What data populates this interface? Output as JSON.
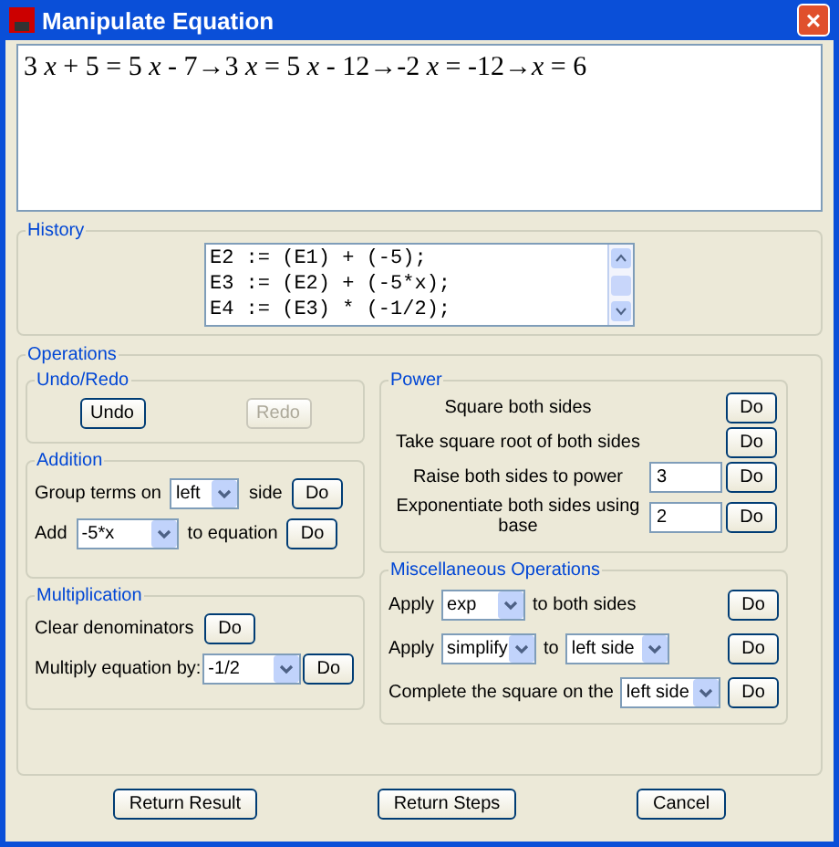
{
  "window": {
    "title": "Manipulate Equation",
    "close": "×"
  },
  "equation": "3 *x* + 5 = 5 *x* - 7→3 *x* = 5 *x* - 12→-2 *x* = -12→*x* = 6",
  "history": {
    "title": "History",
    "lines": [
      "E2 := (E1) + (-5);",
      "E3 := (E2) + (-5*x);",
      "E4 := (E3) * (-1/2);"
    ]
  },
  "operations": {
    "title": "Operations",
    "undo_redo": {
      "title": "Undo/Redo",
      "buttons": [
        {
          "label": "Undo",
          "disabled": false
        },
        {
          "label": "Redo",
          "disabled": true
        }
      ]
    },
    "addition": {
      "title": "Addition",
      "rows": [
        {
          "before": "Group terms on",
          "value": "left",
          "after": "side",
          "button": "Do"
        },
        {
          "before": "Add",
          "value": "-5*x",
          "after": "to equation",
          "button": "Do"
        }
      ]
    },
    "multiplication": {
      "title": "Multiplication",
      "rows": [
        {
          "kind": "button",
          "label": "Clear denominators",
          "button": "Do"
        },
        {
          "kind": "select",
          "label": "Multiply equation by:",
          "value": "-1/2",
          "button": "Do"
        }
      ]
    },
    "power": {
      "title": "Power",
      "rows": [
        {
          "label": "Square both sides",
          "button": "Do"
        },
        {
          "label": "Take square root of both sides",
          "button": "Do"
        },
        {
          "label": "Raise both sides to power",
          "value": "3",
          "button": "Do"
        },
        {
          "label": "Exponentiate both sides using base",
          "value": "2",
          "button": "Do"
        }
      ]
    },
    "misc": {
      "title": "Miscellaneous Operations",
      "rows": [
        {
          "items": [
            {
              "kind": "label",
              "text": "Apply"
            },
            {
              "kind": "select",
              "text": "exp"
            },
            {
              "kind": "label",
              "text": "to both sides"
            },
            {
              "kind": "button",
              "text": "Do"
            }
          ]
        },
        {
          "items": [
            {
              "kind": "label",
              "text": "Apply"
            },
            {
              "kind": "select",
              "text": "simplify"
            },
            {
              "kind": "label",
              "text": "to"
            },
            {
              "kind": "select",
              "text": "left side"
            },
            {
              "kind": "button",
              "text": "Do"
            }
          ]
        },
        {
          "items": [
            {
              "kind": "label",
              "text": "Complete the square on the"
            },
            {
              "kind": "select",
              "text": "left side"
            },
            {
              "kind": "button",
              "text": "Do"
            }
          ]
        }
      ]
    }
  },
  "footer": [
    "Return Result",
    "Return Steps",
    "Cancel"
  ]
}
